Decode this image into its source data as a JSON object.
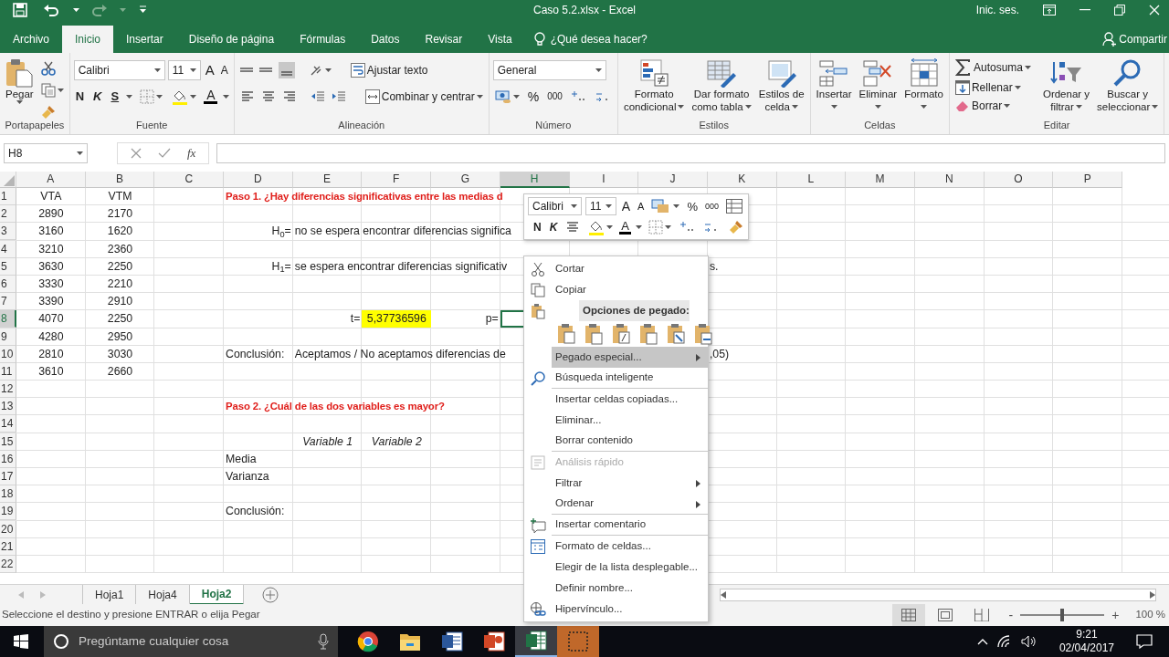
{
  "title_bar": {
    "title": "Caso 5.2.xlsx  -  Excel",
    "account": "Inic. ses."
  },
  "ribbon_tabs": [
    {
      "label": "Archivo",
      "selected": false
    },
    {
      "label": "Inicio",
      "selected": true
    },
    {
      "label": "Insertar",
      "selected": false
    },
    {
      "label": "Diseño de página",
      "selected": false
    },
    {
      "label": "Fórmulas",
      "selected": false
    },
    {
      "label": "Datos",
      "selected": false
    },
    {
      "label": "Revisar",
      "selected": false
    },
    {
      "label": "Vista",
      "selected": false
    }
  ],
  "tell_me": {
    "placeholder": "¿Qué desea hacer?"
  },
  "share": "Compartir",
  "ribbon_groups": [
    {
      "kind": "clipboard",
      "label": "Portapapeles",
      "paste": "Pegar"
    },
    {
      "kind": "font",
      "label": "Fuente",
      "family": "Calibri",
      "size": "11",
      "grow": "A",
      "shrink": "A",
      "bold": "N",
      "italic": "K",
      "underline": "S",
      "color_letter": "A"
    },
    {
      "kind": "alignment",
      "label": "Alineación",
      "wrap": "Ajustar texto",
      "merge": "Combinar y centrar"
    },
    {
      "kind": "number",
      "label": "Número",
      "format": "General",
      "percent": "%",
      "thousands": "000"
    },
    {
      "kind": "large",
      "label": "Estilos",
      "buttons": [
        {
          "kind": "conditional",
          "lines": [
            "Formato",
            "condicional"
          ]
        },
        {
          "kind": "table",
          "lines": [
            "Dar formato",
            "como tabla"
          ]
        },
        {
          "kind": "cellstyle",
          "lines": [
            "Estilos de",
            "celda"
          ]
        }
      ]
    },
    {
      "kind": "large",
      "label": "Celdas",
      "buttons": [
        {
          "kind": "insert",
          "lines": [
            "Insertar"
          ]
        },
        {
          "kind": "delete",
          "lines": [
            "Eliminar"
          ]
        },
        {
          "kind": "format",
          "lines": [
            "Formato"
          ]
        }
      ]
    },
    {
      "kind": "editing",
      "label": "Editar",
      "small": [
        {
          "kind": "sum",
          "label": "Autosuma"
        },
        {
          "kind": "fill",
          "label": "Rellenar"
        },
        {
          "kind": "clear",
          "label": "Borrar"
        }
      ],
      "buttons": [
        {
          "kind": "sort",
          "lines": [
            "Ordenar y",
            "filtrar"
          ]
        },
        {
          "kind": "find",
          "lines": [
            "Buscar y",
            "seleccionar"
          ]
        }
      ]
    }
  ],
  "formula_bar": {
    "name_box": "H8",
    "function_label": "fx"
  },
  "columns": [
    {
      "label": "A",
      "selected": false
    },
    {
      "label": "B",
      "selected": false
    },
    {
      "label": "C",
      "selected": false
    },
    {
      "label": "D",
      "selected": false
    },
    {
      "label": "E",
      "selected": false
    },
    {
      "label": "F",
      "selected": false
    },
    {
      "label": "G",
      "selected": false
    },
    {
      "label": "H",
      "selected": true
    },
    {
      "label": "I",
      "selected": false
    },
    {
      "label": "J",
      "selected": false
    },
    {
      "label": "K",
      "selected": false
    },
    {
      "label": "L",
      "selected": false
    },
    {
      "label": "M",
      "selected": false
    },
    {
      "label": "N",
      "selected": false
    },
    {
      "label": "O",
      "selected": false
    },
    {
      "label": "P",
      "selected": false
    }
  ],
  "rows": [
    {
      "label": "1",
      "selected": false,
      "cells": {
        "A": {
          "text": "VTA",
          "kind": "centered"
        },
        "B": {
          "text": "VTM",
          "kind": "centered"
        },
        "D": {
          "text": "Paso 1. ¿Hay diferencias significativas entre las medias d",
          "kind": "heading"
        }
      }
    },
    {
      "label": "2",
      "selected": false,
      "cells": {
        "A": {
          "text": "2890",
          "kind": "centered"
        },
        "B": {
          "text": "2170",
          "kind": "centered"
        }
      }
    },
    {
      "label": "3",
      "selected": false,
      "cells": {
        "A": {
          "text": "3160",
          "kind": "centered"
        },
        "B": {
          "text": "1620",
          "kind": "centered"
        },
        "D": {
          "text": "H$_{0}$=",
          "kind": "right"
        },
        "E": {
          "text": "no se espera encontrar diferencias significa",
          "kind": "plain"
        }
      }
    },
    {
      "label": "4",
      "selected": false,
      "cells": {
        "A": {
          "text": "3210",
          "kind": "centered"
        },
        "B": {
          "text": "2360",
          "kind": "centered"
        }
      }
    },
    {
      "label": "5",
      "selected": false,
      "cells": {
        "A": {
          "text": "3630",
          "kind": "centered"
        },
        "B": {
          "text": "2250",
          "kind": "centered"
        },
        "D": {
          "text": "H$_{1}$=",
          "kind": "right"
        },
        "E": {
          "text": "se espera encontrar diferencias significativ",
          "kind": "plain"
        },
        "K": {
          "text": "s.",
          "kind": "plain"
        }
      }
    },
    {
      "label": "6",
      "selected": false,
      "cells": {
        "A": {
          "text": "3330",
          "kind": "centered"
        },
        "B": {
          "text": "2210",
          "kind": "centered"
        }
      }
    },
    {
      "label": "7",
      "selected": false,
      "cells": {
        "A": {
          "text": "3390",
          "kind": "centered"
        },
        "B": {
          "text": "2910",
          "kind": "centered"
        }
      }
    },
    {
      "label": "8",
      "selected": true,
      "cells": {
        "A": {
          "text": "4070",
          "kind": "centered"
        },
        "B": {
          "text": "2250",
          "kind": "centered"
        },
        "E": {
          "text": "t=",
          "kind": "right"
        },
        "F": {
          "text": "5,37736596",
          "kind": "highlight"
        },
        "G": {
          "text": "p=",
          "kind": "right"
        }
      }
    },
    {
      "label": "9",
      "selected": false,
      "cells": {
        "A": {
          "text": "4280",
          "kind": "centered"
        },
        "B": {
          "text": "2950",
          "kind": "centered"
        }
      }
    },
    {
      "label": "10",
      "selected": false,
      "cells": {
        "A": {
          "text": "2810",
          "kind": "centered"
        },
        "B": {
          "text": "3030",
          "kind": "centered"
        },
        "D": {
          "text": "Conclusión:",
          "kind": "plain"
        },
        "E": {
          "text": "Aceptamos / No aceptamos diferencias de",
          "kind": "plain"
        },
        "K": {
          "text": ",05)",
          "kind": "plain"
        }
      }
    },
    {
      "label": "11",
      "selected": false,
      "cells": {
        "A": {
          "text": "3610",
          "kind": "centered"
        },
        "B": {
          "text": "2660",
          "kind": "centered"
        }
      }
    },
    {
      "label": "12",
      "selected": false
    },
    {
      "label": "13",
      "selected": false,
      "cells": {
        "D": {
          "text": "Paso 2. ¿Cuál de las dos variables es mayor?",
          "kind": "heading"
        }
      }
    },
    {
      "label": "14",
      "selected": false
    },
    {
      "label": "15",
      "selected": false,
      "cells": {
        "E": {
          "text": "Variable 1",
          "kind": "italic"
        },
        "F": {
          "text": "Variable 2",
          "kind": "italic"
        }
      }
    },
    {
      "label": "16",
      "selected": false,
      "cells": {
        "D": {
          "text": "Media",
          "kind": "plain"
        }
      }
    },
    {
      "label": "17",
      "selected": false,
      "cells": {
        "D": {
          "text": "Varianza",
          "kind": "plain"
        }
      }
    },
    {
      "label": "18",
      "selected": false
    },
    {
      "label": "19",
      "selected": false,
      "cells": {
        "D": {
          "text": "Conclusión:",
          "kind": "plain"
        }
      }
    },
    {
      "label": "20",
      "selected": false
    },
    {
      "label": "21",
      "selected": false
    },
    {
      "label": "22",
      "selected": false
    }
  ],
  "sheet_tabs": [
    {
      "label": "Hoja1",
      "selected": false
    },
    {
      "label": "Hoja4",
      "selected": false
    },
    {
      "label": "Hoja2",
      "selected": true
    }
  ],
  "status_bar": {
    "message": "Seleccione el destino y presione ENTRAR o elija Pegar",
    "views": [
      {
        "kind": "normal",
        "selected": true
      },
      {
        "kind": "page-layout",
        "selected": false
      },
      {
        "kind": "page-break",
        "selected": false
      }
    ],
    "zoom_out": "-",
    "zoom_in": "+",
    "zoom": {
      "level": 0.5,
      "reading": "100 %"
    }
  },
  "mini_toolbar": {
    "family": "Calibri",
    "size": "11",
    "grow": "A",
    "shrink": "A",
    "percent": "%",
    "thousands": "000",
    "bold": "N",
    "italic": "K",
    "color_letter": "A"
  },
  "context_menu": [
    {
      "kind": "cut",
      "label": "Cortar",
      "selected": false,
      "disabled": false,
      "submenu": false,
      "divider_after": false
    },
    {
      "kind": "copy",
      "label": "Copiar",
      "selected": false,
      "disabled": false,
      "submenu": false,
      "divider_after": false
    },
    {
      "kind": "paste-header",
      "label": "Opciones de pegado:",
      "selected": false,
      "disabled": false,
      "submenu": false,
      "divider_after": false
    },
    {
      "kind": "paste-options",
      "selected": false,
      "disabled": false,
      "submenu": false,
      "divider_after": false
    },
    {
      "kind": "plain",
      "label": "Pegado especial...",
      "selected": true,
      "disabled": false,
      "submenu": true,
      "divider_after": false
    },
    {
      "kind": "lookup",
      "label": "Búsqueda inteligente",
      "selected": false,
      "disabled": false,
      "submenu": false,
      "divider_after": true
    },
    {
      "kind": "plain",
      "label": "Insertar celdas copiadas...",
      "selected": false,
      "disabled": false,
      "submenu": false,
      "divider_after": false
    },
    {
      "kind": "plain",
      "label": "Eliminar...",
      "selected": false,
      "disabled": false,
      "submenu": false,
      "divider_after": false
    },
    {
      "kind": "plain",
      "label": "Borrar contenido",
      "selected": false,
      "disabled": false,
      "submenu": false,
      "divider_after": true
    },
    {
      "kind": "quick",
      "label": "Análisis rápido",
      "selected": false,
      "disabled": true,
      "submenu": false,
      "divider_after": false
    },
    {
      "kind": "plain",
      "label": "Filtrar",
      "selected": false,
      "disabled": false,
      "submenu": true,
      "divider_after": false
    },
    {
      "kind": "plain",
      "label": "Ordenar",
      "selected": false,
      "disabled": false,
      "submenu": true,
      "divider_after": true
    },
    {
      "kind": "comment",
      "label": "Insertar comentario",
      "selected": false,
      "disabled": false,
      "submenu": false,
      "divider_after": true
    },
    {
      "kind": "format",
      "label": "Formato de celdas...",
      "selected": false,
      "disabled": false,
      "submenu": false,
      "divider_after": false
    },
    {
      "kind": "plain",
      "label": "Elegir de la lista desplegable...",
      "selected": false,
      "disabled": false,
      "submenu": false,
      "divider_after": false
    },
    {
      "kind": "plain",
      "label": "Definir nombre...",
      "selected": false,
      "disabled": false,
      "submenu": false,
      "divider_after": false
    },
    {
      "kind": "link",
      "label": "Hipervínculo...",
      "selected": false,
      "disabled": false,
      "submenu": false,
      "divider_after": false
    }
  ],
  "taskbar": {
    "search": {
      "placeholder": "Pregúntame cualquier cosa"
    },
    "apps": [
      {
        "kind": "chrome",
        "selected": false
      },
      {
        "kind": "folder",
        "selected": false
      },
      {
        "kind": "word",
        "selected": false
      },
      {
        "kind": "powerpoint",
        "selected": false
      },
      {
        "kind": "excel",
        "selected": true
      },
      {
        "kind": "other",
        "selected": false
      }
    ],
    "time": "9:21",
    "date": "02/04/2017"
  }
}
